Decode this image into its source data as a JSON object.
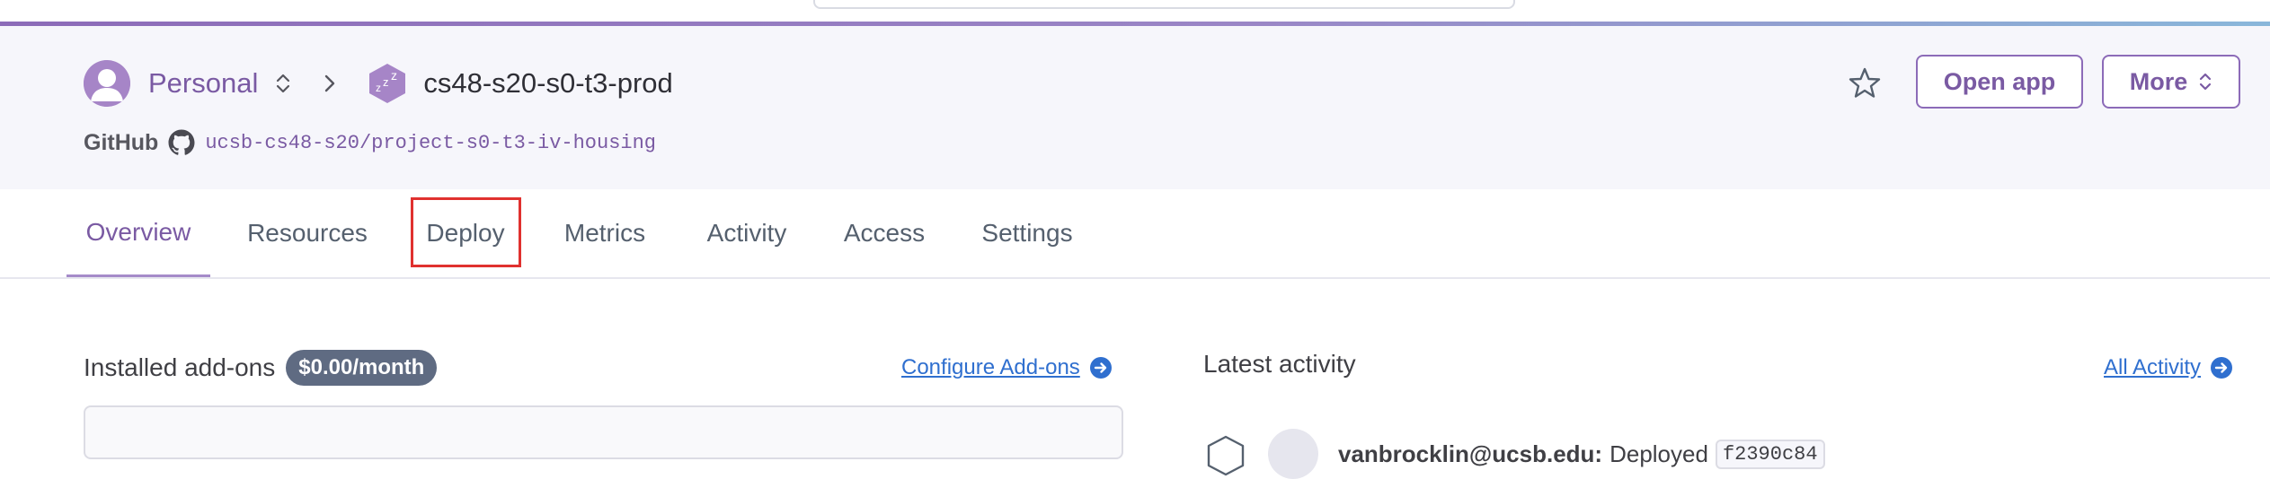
{
  "header": {
    "owner_name": "Personal",
    "app_name": "cs48-s20-s0-t3-prod",
    "github_label": "GitHub",
    "repo": "ucsb-cs48-s20/project-s0-t3-iv-housing",
    "open_app_label": "Open app",
    "more_label": "More"
  },
  "icons": {
    "avatar": "user-avatar-icon",
    "owner_switch": "updown-chevron-icon",
    "breadcrumb": "chevron-right-icon",
    "app": "sleeping-dyno-icon",
    "github": "github-icon",
    "star": "star-icon",
    "more": "updown-chevron-icon"
  },
  "tabs": [
    {
      "label": "Overview",
      "active": true
    },
    {
      "label": "Resources",
      "active": false
    },
    {
      "label": "Deploy",
      "active": false
    },
    {
      "label": "Metrics",
      "active": false
    },
    {
      "label": "Activity",
      "active": false
    },
    {
      "label": "Access",
      "active": false
    },
    {
      "label": "Settings",
      "active": false
    }
  ],
  "addons": {
    "title": "Installed add-ons",
    "price": "$0.00/month",
    "configure_label": "Configure Add-ons"
  },
  "activity": {
    "title": "Latest activity",
    "all_label": "All Activity",
    "items": [
      {
        "user": "vanbrocklin@ucsb.edu:",
        "action": "Deployed",
        "commit": "f2390c84"
      }
    ]
  },
  "colors": {
    "accent": "#7a5aa3",
    "link": "#2f6fcf",
    "badge": "#5f6b82",
    "highlight": "#e0312f"
  }
}
